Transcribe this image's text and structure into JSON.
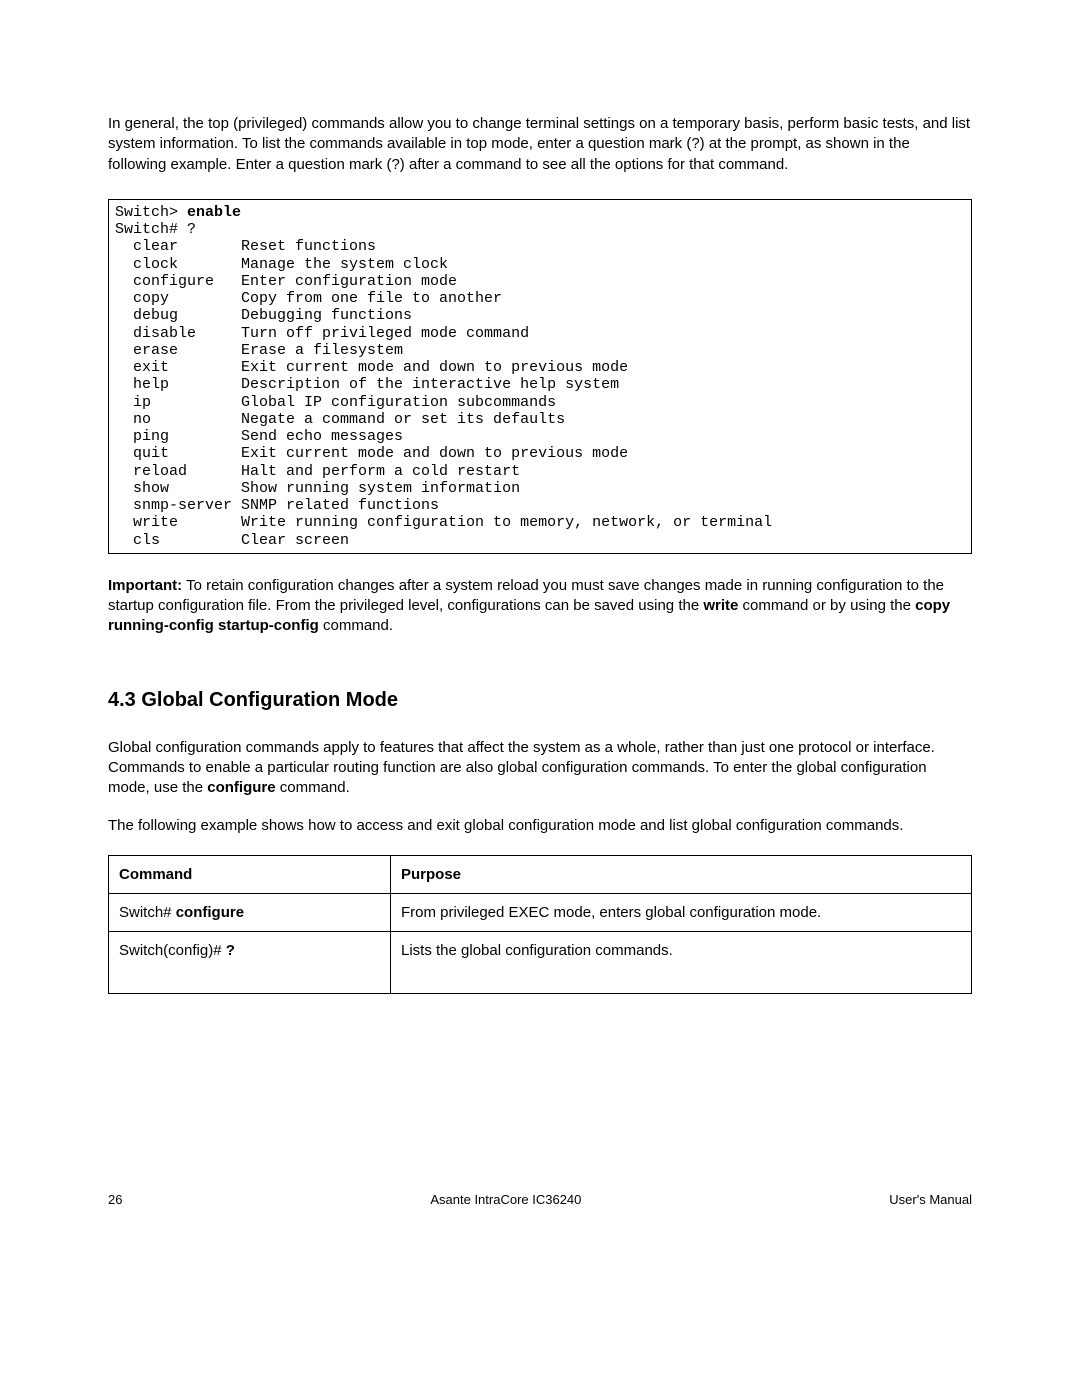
{
  "intro": "In general, the top (privileged) commands allow you to change terminal settings on a temporary basis, perform basic tests, and list system information. To list the commands available in top mode, enter a question mark (?) at the prompt, as shown in the following example. Enter a question mark (?) after a command to see all the options for that command.",
  "terminal": {
    "line1_prompt": "Switch> ",
    "line1_cmd": "enable",
    "line2": "Switch# ?",
    "commands": [
      {
        "name": "clear",
        "desc": "Reset functions"
      },
      {
        "name": "clock",
        "desc": "Manage the system clock"
      },
      {
        "name": "configure",
        "desc": "Enter configuration mode"
      },
      {
        "name": "copy",
        "desc": "Copy from one file to another"
      },
      {
        "name": "debug",
        "desc": "Debugging functions"
      },
      {
        "name": "disable",
        "desc": "Turn off privileged mode command"
      },
      {
        "name": "erase",
        "desc": "Erase a filesystem"
      },
      {
        "name": "exit",
        "desc": "Exit current mode and down to previous mode"
      },
      {
        "name": "help",
        "desc": "Description of the interactive help system"
      },
      {
        "name": "ip",
        "desc": "Global IP configuration subcommands"
      },
      {
        "name": "no",
        "desc": "Negate a command or set its defaults"
      },
      {
        "name": "ping",
        "desc": "Send echo messages"
      },
      {
        "name": "quit",
        "desc": "Exit current mode and down to previous mode"
      },
      {
        "name": "reload",
        "desc": "Halt and perform a cold restart"
      },
      {
        "name": "show",
        "desc": "Show running system information"
      },
      {
        "name": "snmp-server",
        "desc": "SNMP related functions"
      },
      {
        "name": "write",
        "desc": "Write running configuration to memory, network, or terminal"
      },
      {
        "name": "cls",
        "desc": "Clear screen"
      }
    ]
  },
  "important": {
    "label": "Important:",
    "text1": " To retain configuration changes after a system reload you must save changes made in running configuration to the startup configuration file. From the privileged level, configurations can be saved using the ",
    "bold1": "write",
    "text2": " command or by using the ",
    "bold2": "copy running-config startup-config",
    "text3": " command."
  },
  "section": {
    "heading": "4.3 Global Configuration Mode",
    "para1_a": "Global configuration commands apply to features that affect the system as a whole, rather than just one protocol or interface. Commands to enable a particular routing function are also global configuration commands. To enter the global configuration mode, use the ",
    "para1_bold": "configure",
    "para1_b": " command.",
    "para2": "The following example shows how to access and exit global configuration mode and list global configuration commands."
  },
  "table": {
    "header_cmd": "Command",
    "header_purpose": "Purpose",
    "rows": [
      {
        "cmd_prefix": "Switch# ",
        "cmd_bold": "configure",
        "purpose": "From privileged EXEC mode, enters global configuration mode."
      },
      {
        "cmd_prefix": "Switch(config)# ",
        "cmd_bold": "?",
        "purpose": "Lists the global configuration commands."
      }
    ]
  },
  "footer": {
    "page_num": "26",
    "center": "Asante IntraCore IC36240",
    "right": "User's Manual"
  }
}
